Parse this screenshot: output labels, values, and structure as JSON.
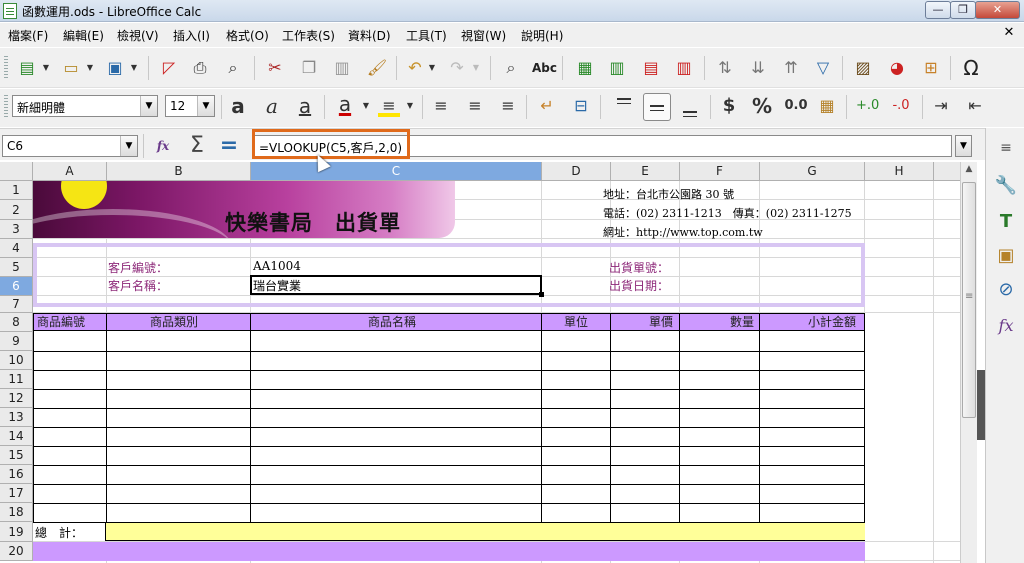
{
  "window": {
    "title": "函數運用.ods - LibreOffice Calc",
    "min_icon": "—",
    "max_icon": "❐",
    "close_icon": "✕"
  },
  "menu": [
    "檔案(F)",
    "編輯(E)",
    "檢視(V)",
    "插入(I)",
    "格式(O)",
    "工作表(S)",
    "資料(D)",
    "工具(T)",
    "視窗(W)",
    "說明(H)"
  ],
  "menu_close": "✕",
  "toolbar2": {
    "font_name": "新細明體",
    "font_size": "12",
    "bold": "a",
    "italic": "a",
    "underline": "a",
    "font_color_glyph": "a",
    "currency": "$",
    "percent": "%",
    "number": "0.0"
  },
  "formula_bar": {
    "cell_ref": "C6",
    "formula": "=VLOOKUP(C5,客戶,2,0)",
    "fx_label": "fx",
    "sum_label": "Σ",
    "equals_label": "="
  },
  "columns": [
    "A",
    "B",
    "C",
    "D",
    "E",
    "F",
    "G",
    "H"
  ],
  "selected_column": "C",
  "rows": [
    "1",
    "2",
    "3",
    "4",
    "5",
    "6",
    "7",
    "8",
    "9",
    "10",
    "11",
    "12",
    "13",
    "14",
    "15",
    "16",
    "17",
    "18",
    "19",
    "20"
  ],
  "selected_row": "6",
  "sheet": {
    "banner_title": "快樂書局　出貨單",
    "address": "地址：台北市公園路 30 號",
    "phone": "電話：(02) 2311-1213　傳真：(02) 2311-1275",
    "website": "網址：http://www.top.com.tw",
    "customer_id_label": "客戶編號：",
    "customer_id_value": "AA1004",
    "customer_name_label": "客戶名稱：",
    "customer_name_value": "瑞台實業",
    "shipment_no_label": "出貨單號：",
    "ship_date_label": "出貨日期：",
    "item_headers": [
      "商品編號",
      "商品類別",
      "商品名稱",
      "單位",
      "單價",
      "數量",
      "小計金額"
    ],
    "total_label": "總　計："
  },
  "colors": {
    "header_purple": "#cc99ff",
    "total_yellow": "#ffff99",
    "highlight_orange": "#e06a1b",
    "selection_blue": "#7ea9e0"
  }
}
